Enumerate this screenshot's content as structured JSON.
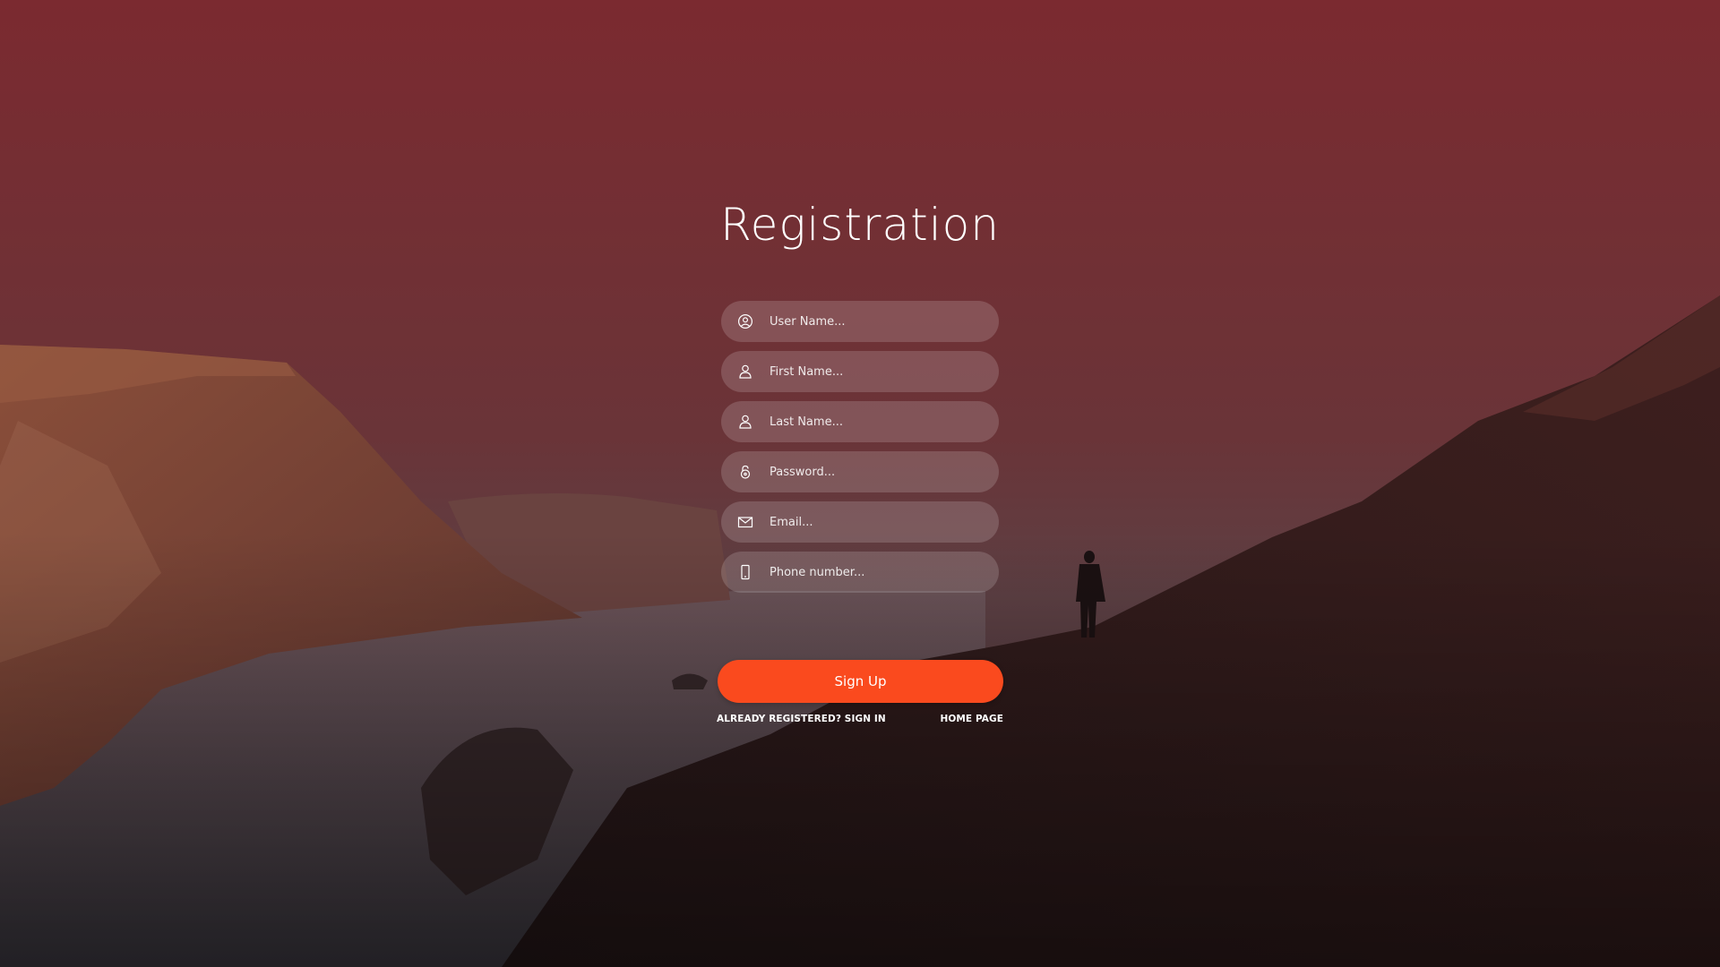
{
  "page": {
    "title": "Registration"
  },
  "form": {
    "fields": [
      {
        "placeholder": "User Name...",
        "icon": "user-circle-icon"
      },
      {
        "placeholder": "First Name...",
        "icon": "user-icon"
      },
      {
        "placeholder": "Last Name...",
        "icon": "user-icon"
      },
      {
        "placeholder": "Password...",
        "icon": "lock-icon"
      },
      {
        "placeholder": "Email...",
        "icon": "envelope-icon"
      },
      {
        "placeholder": "Phone number...",
        "icon": "phone-icon"
      }
    ],
    "submit_label": "Sign Up"
  },
  "links": {
    "signin": "ALREADY REGISTERED? SIGN IN",
    "home": "HOME PAGE"
  },
  "colors": {
    "accent": "#fa4a1e",
    "overlay_top": "#7a2a31",
    "overlay_bottom": "#1e1717"
  }
}
